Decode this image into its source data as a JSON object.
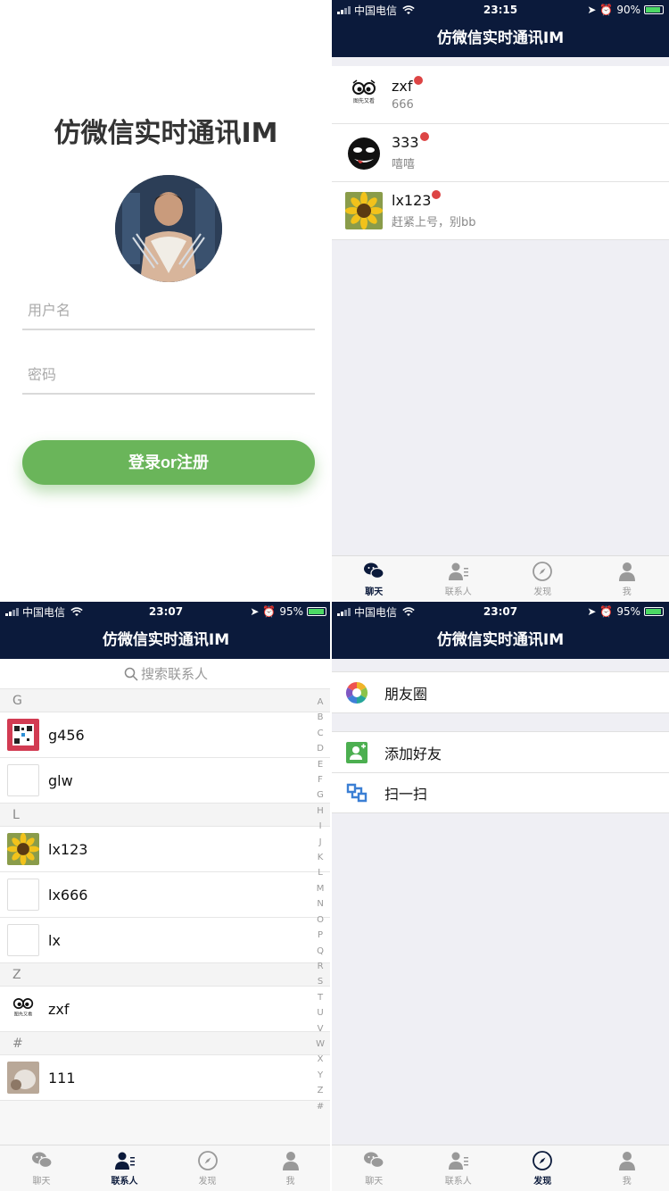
{
  "login": {
    "title": "仿微信实时通讯IM",
    "username_placeholder": "用户名",
    "password_placeholder": "密码",
    "button_label": "登录or注册"
  },
  "status_a": {
    "carrier": "中国电信",
    "time": "23:15",
    "battery": "90%"
  },
  "status_b": {
    "carrier": "中国电信",
    "time": "23:07",
    "battery": "95%"
  },
  "nav_title": "仿微信实时通讯IM",
  "chats": [
    {
      "name": "zxf",
      "message": "666",
      "avatar": "eyes-logo"
    },
    {
      "name": "333",
      "message": "嘻嘻",
      "avatar": "black-face"
    },
    {
      "name": "lx123",
      "message": "赶紧上号，别bb",
      "avatar": "sunflower"
    }
  ],
  "tabs": [
    {
      "label": "聊天",
      "icon": "chat-icon"
    },
    {
      "label": "联系人",
      "icon": "contacts-icon"
    },
    {
      "label": "发现",
      "icon": "compass-icon"
    },
    {
      "label": "我",
      "icon": "person-icon"
    }
  ],
  "contacts": {
    "search_placeholder": "搜索联系人",
    "sections": [
      {
        "letter": "G",
        "items": [
          {
            "name": "g456",
            "avatar": "qr"
          },
          {
            "name": "glw",
            "avatar": "empty"
          }
        ]
      },
      {
        "letter": "L",
        "items": [
          {
            "name": "lx123",
            "avatar": "sunflower"
          },
          {
            "name": "lx666",
            "avatar": "empty"
          },
          {
            "name": "lx",
            "avatar": "empty"
          }
        ]
      },
      {
        "letter": "Z",
        "items": [
          {
            "name": "zxf",
            "avatar": "eyes-logo"
          }
        ]
      },
      {
        "letter": "#",
        "items": [
          {
            "name": "111",
            "avatar": "photo"
          }
        ]
      }
    ],
    "index": [
      "A",
      "B",
      "C",
      "D",
      "E",
      "F",
      "G",
      "H",
      "I",
      "J",
      "K",
      "L",
      "M",
      "N",
      "O",
      "P",
      "Q",
      "R",
      "S",
      "T",
      "U",
      "V",
      "W",
      "X",
      "Y",
      "Z",
      "#"
    ]
  },
  "discover": {
    "moments": "朋友圈",
    "add_friend": "添加好友",
    "scan": "扫一扫"
  },
  "eyes_logo_text": "图先又看",
  "colors": {
    "nav": "#0b1a3b",
    "accent_green": "#6ab55a",
    "unread_dot": "#d44444"
  }
}
